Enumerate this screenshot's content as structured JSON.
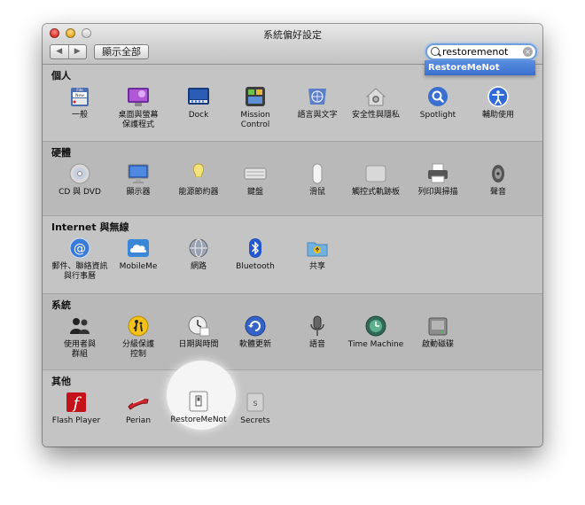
{
  "window": {
    "title": "系統偏好設定",
    "nav_back": "◀",
    "nav_forward": "▶",
    "show_all": "顯示全部"
  },
  "search": {
    "value": "restoremenot",
    "clear_glyph": "×",
    "suggestion": "RestoreMeNot"
  },
  "sections": {
    "personal": {
      "title": "個人",
      "items": [
        {
          "label": "一般",
          "icon": "file-new-open-icon"
        },
        {
          "label": "桌面與螢幕\n保護程式",
          "icon": "desktop-screensaver-icon"
        },
        {
          "label": "Dock",
          "icon": "dock-icon"
        },
        {
          "label": "Mission\nControl",
          "icon": "mission-control-icon"
        },
        {
          "label": "語言與文字",
          "icon": "flag-globe-icon"
        },
        {
          "label": "安全性與隱私",
          "icon": "house-lock-icon"
        },
        {
          "label": "Spotlight",
          "icon": "magnifier-icon"
        },
        {
          "label": "輔助使用",
          "icon": "accessibility-icon"
        }
      ]
    },
    "hardware": {
      "title": "硬體",
      "items": [
        {
          "label": "CD 與 DVD",
          "icon": "disc-icon"
        },
        {
          "label": "顯示器",
          "icon": "monitor-icon"
        },
        {
          "label": "能源節約器",
          "icon": "lightbulb-icon"
        },
        {
          "label": "鍵盤",
          "icon": "keyboard-icon"
        },
        {
          "label": "滑鼠",
          "icon": "mouse-icon"
        },
        {
          "label": "觸控式軌跡板",
          "icon": "trackpad-icon"
        },
        {
          "label": "列印與掃描",
          "icon": "printer-icon"
        },
        {
          "label": "聲音",
          "icon": "speaker-icon"
        }
      ]
    },
    "internet": {
      "title": "Internet 與無線",
      "items": [
        {
          "label": "郵件、聯絡資訊\n與行事曆",
          "icon": "at-sign-icon"
        },
        {
          "label": "MobileMe",
          "icon": "cloud-icon"
        },
        {
          "label": "網路",
          "icon": "network-globe-icon"
        },
        {
          "label": "Bluetooth",
          "icon": "bluetooth-icon"
        },
        {
          "label": "共享",
          "icon": "shared-folder-icon"
        }
      ]
    },
    "system": {
      "title": "系統",
      "items": [
        {
          "label": "使用者與\n群組",
          "icon": "users-icon"
        },
        {
          "label": "分級保護\n控制",
          "icon": "parental-controls-icon"
        },
        {
          "label": "日期與時間",
          "icon": "clock-calendar-icon"
        },
        {
          "label": "軟體更新",
          "icon": "software-update-icon"
        },
        {
          "label": "語音",
          "icon": "microphone-icon"
        },
        {
          "label": "Time Machine",
          "icon": "time-machine-icon"
        },
        {
          "label": "啟動磁碟",
          "icon": "startup-disk-icon"
        }
      ]
    },
    "other": {
      "title": "其他",
      "items": [
        {
          "label": "Flash Player",
          "icon": "flash-icon"
        },
        {
          "label": "Perian",
          "icon": "perian-knife-icon"
        },
        {
          "label": "RestoreMeNot",
          "icon": "switch-icon"
        },
        {
          "label": "Secrets",
          "icon": "secrets-icon"
        }
      ]
    }
  },
  "glyphs": {
    "at": "@",
    "secrets": "s",
    "flash": "f",
    "file_small": "File",
    "file_new": "New"
  },
  "colors": {
    "accent": "#3a6fcf",
    "window_bg": "#bdbdbd"
  }
}
